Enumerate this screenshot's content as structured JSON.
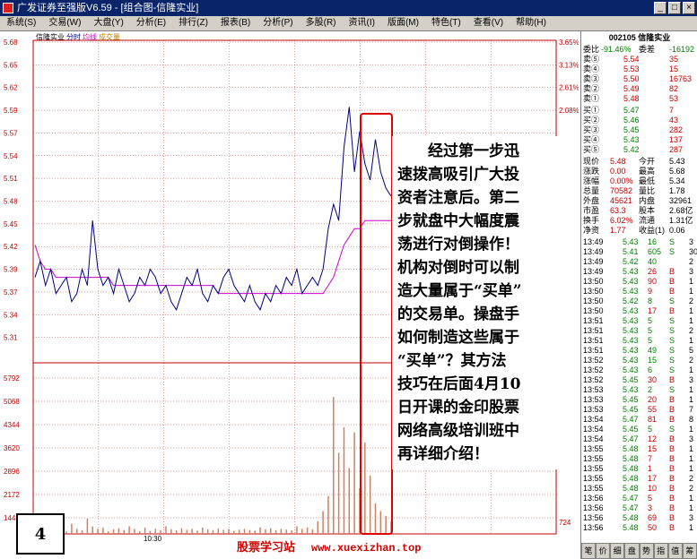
{
  "window": {
    "title": "广发证券至强版V6.59 - [组合图-信隆实业]"
  },
  "menu": [
    "系统(S)",
    "交易(W)",
    "大盘(Y)",
    "分析(E)",
    "排行(Z)",
    "报表(B)",
    "分析(P)",
    "多股(R)",
    "资讯(I)",
    "版面(M)",
    "特色(T)",
    "查看(V)",
    "帮助(H)"
  ],
  "chart": {
    "stock_name": "信隆实业",
    "labels": [
      "分时",
      "均线",
      "成交量"
    ],
    "price_ticks": [
      "5.68",
      "5.65",
      "5.62",
      "5.59",
      "5.57",
      "5.54",
      "5.51",
      "5.48",
      "5.45",
      "5.42",
      "5.39",
      "5.37",
      "5.34",
      "5.31"
    ],
    "pct_ticks": [
      "3.65%",
      "3.13%",
      "2.61%",
      "2.08%"
    ],
    "volume_ticks": [
      "5792",
      "5068",
      "4344",
      "3620",
      "2896",
      "2172",
      "1448"
    ],
    "volume_right": "724",
    "time_label": "10:30",
    "price_line": [
      5.39,
      5.41,
      5.38,
      5.4,
      5.37,
      5.38,
      5.39,
      5.36,
      5.37,
      5.4,
      5.38,
      5.46,
      5.4,
      5.38,
      5.39,
      5.37,
      5.4,
      5.38,
      5.36,
      5.37,
      5.39,
      5.38,
      5.4,
      5.39,
      5.37,
      5.38,
      5.36,
      5.35,
      5.37,
      5.39,
      5.38,
      5.4,
      5.37,
      5.36,
      5.38,
      5.37,
      5.39,
      5.4,
      5.38,
      5.37,
      5.36,
      5.38,
      5.36,
      5.35,
      5.37,
      5.36,
      5.38,
      5.37,
      5.39,
      5.38,
      5.4,
      5.37,
      5.38,
      5.39,
      5.38,
      5.4,
      5.45,
      5.48,
      5.46,
      5.55,
      5.6,
      5.52,
      5.57,
      5.53,
      5.51,
      5.56,
      5.52,
      5.5,
      5.49
    ],
    "avg_line": [
      5.43,
      5.41,
      5.4,
      5.4,
      5.39,
      5.39,
      5.39,
      5.39,
      5.39,
      5.39,
      5.39,
      5.39,
      5.39,
      5.39,
      5.39,
      5.38,
      5.38,
      5.38,
      5.38,
      5.38,
      5.38,
      5.38,
      5.38,
      5.38,
      5.38,
      5.38,
      5.38,
      5.38,
      5.38,
      5.38,
      5.38,
      5.38,
      5.38,
      5.38,
      5.38,
      5.37,
      5.37,
      5.37,
      5.37,
      5.37,
      5.37,
      5.37,
      5.37,
      5.37,
      5.37,
      5.37,
      5.37,
      5.37,
      5.37,
      5.37,
      5.37,
      5.37,
      5.37,
      5.37,
      5.37,
      5.37,
      5.38,
      5.39,
      5.41,
      5.43,
      5.44,
      5.45,
      5.45,
      5.46,
      5.46,
      5.46,
      5.46,
      5.46,
      5.46
    ],
    "volumes": [
      300,
      200,
      500,
      150,
      700,
      250,
      100,
      400,
      200,
      150,
      600,
      300,
      200,
      250,
      100,
      180,
      220,
      150,
      300,
      200,
      100,
      250,
      120,
      200,
      150,
      300,
      180,
      140,
      220,
      160,
      200,
      130,
      250,
      180,
      150,
      210,
      160,
      190,
      120,
      170,
      200,
      150,
      130,
      260,
      180,
      220,
      150,
      200,
      170,
      140,
      300,
      200,
      260,
      180,
      500,
      900,
      1500,
      5400,
      3200,
      4200,
      2600,
      4000,
      1800,
      3600,
      2300,
      1200,
      900,
      700,
      500
    ]
  },
  "overlay": {
    "text": [
      "经过第一步迅",
      "速拨高吸引广大投",
      "资者注意后。第二",
      "步就盘中大幅度震",
      "荡进行对倒操作！",
      "机构对倒时可以制",
      "造大量属于“买单”",
      "的交易单。操盘手",
      "如何制造这些属于",
      "“买单”？其方法",
      "技巧在后面4月10",
      "日开课的金印股票",
      "网络高级培训班中",
      "再详细介绍！"
    ]
  },
  "page_number": "4",
  "watermark": {
    "name": "股票学习站",
    "site": "www.xuexizhan.top"
  },
  "quote": {
    "code_name": "002105 信隆实业",
    "ratio_row": [
      "委比",
      "-91.46%",
      "委差",
      "-16192"
    ],
    "sells": [
      [
        "卖⑤",
        "5.54",
        "35"
      ],
      [
        "卖④",
        "5.53",
        "15"
      ],
      [
        "卖③",
        "5.50",
        "16763"
      ],
      [
        "卖②",
        "5.49",
        "82"
      ],
      [
        "卖①",
        "5.48",
        "53"
      ]
    ],
    "buys": [
      [
        "买①",
        "5.47",
        "7"
      ],
      [
        "买②",
        "5.46",
        "43"
      ],
      [
        "买③",
        "5.45",
        "282"
      ],
      [
        "买④",
        "5.43",
        "137"
      ],
      [
        "买⑤",
        "5.42",
        "287"
      ]
    ],
    "stats": [
      [
        "现价",
        "5.48",
        "今开",
        "5.43"
      ],
      [
        "涨跌",
        "0.00",
        "最高",
        "5.68"
      ],
      [
        "涨幅",
        "0.00%",
        "最低",
        "5.34"
      ],
      [
        "总量",
        "70582",
        "量比",
        "1.78"
      ],
      [
        "外盘",
        "45621",
        "内盘",
        "32961"
      ],
      [
        "市盈",
        "63.3",
        "股本",
        "2.68亿"
      ],
      [
        "换手",
        "6.02%",
        "流通",
        "1.31亿"
      ],
      [
        "净资",
        "1.77",
        "收益(1)",
        "0.06"
      ]
    ],
    "ticks": [
      [
        "13:49",
        "5.43",
        "16",
        "S",
        "3"
      ],
      [
        "13:49",
        "5.41",
        "605",
        "S",
        "30"
      ],
      [
        "13:49",
        "5.42",
        "40",
        "",
        "2"
      ],
      [
        "13:49",
        "5.43",
        "26",
        "B",
        "3"
      ],
      [
        "13:50",
        "5.43",
        "90",
        "B",
        "1"
      ],
      [
        "13:50",
        "5.43",
        "9",
        "B",
        "1"
      ],
      [
        "13:50",
        "5.42",
        "8",
        "S",
        "2"
      ],
      [
        "13:50",
        "5.43",
        "17",
        "B",
        "1"
      ],
      [
        "13:51",
        "5.43",
        "5",
        "S",
        "1"
      ],
      [
        "13:51",
        "5.43",
        "5",
        "S",
        "2"
      ],
      [
        "13:51",
        "5.43",
        "5",
        "S",
        "1"
      ],
      [
        "13:51",
        "5.43",
        "49",
        "S",
        "5"
      ],
      [
        "13:52",
        "5.43",
        "15",
        "S",
        "2"
      ],
      [
        "13:52",
        "5.43",
        "6",
        "S",
        "1"
      ],
      [
        "13:52",
        "5.45",
        "30",
        "B",
        "3"
      ],
      [
        "13:53",
        "5.43",
        "2",
        "S",
        "1"
      ],
      [
        "13:53",
        "5.45",
        "20",
        "B",
        "1"
      ],
      [
        "13:53",
        "5.45",
        "55",
        "B",
        "7"
      ],
      [
        "13:54",
        "5.47",
        "81",
        "B",
        "8"
      ],
      [
        "13:54",
        "5.45",
        "5",
        "S",
        "1"
      ],
      [
        "13:54",
        "5.47",
        "12",
        "B",
        "3"
      ],
      [
        "13:55",
        "5.48",
        "15",
        "B",
        "1"
      ],
      [
        "13:55",
        "5.48",
        "7",
        "B",
        "1"
      ],
      [
        "13:55",
        "5.48",
        "1",
        "B",
        "1"
      ],
      [
        "13:55",
        "5.48",
        "17",
        "B",
        "2"
      ],
      [
        "13:55",
        "5.48",
        "10",
        "B",
        "2"
      ],
      [
        "13:56",
        "5.47",
        "5",
        "B",
        "1"
      ],
      [
        "13:56",
        "5.47",
        "3",
        "B",
        "1"
      ],
      [
        "13:56",
        "5.48",
        "69",
        "B",
        "3"
      ],
      [
        "13:56",
        "5.48",
        "50",
        "B",
        "1"
      ]
    ],
    "tabs": [
      "笔",
      "价",
      "细",
      "盘",
      "势",
      "指",
      "值",
      "筹"
    ]
  }
}
